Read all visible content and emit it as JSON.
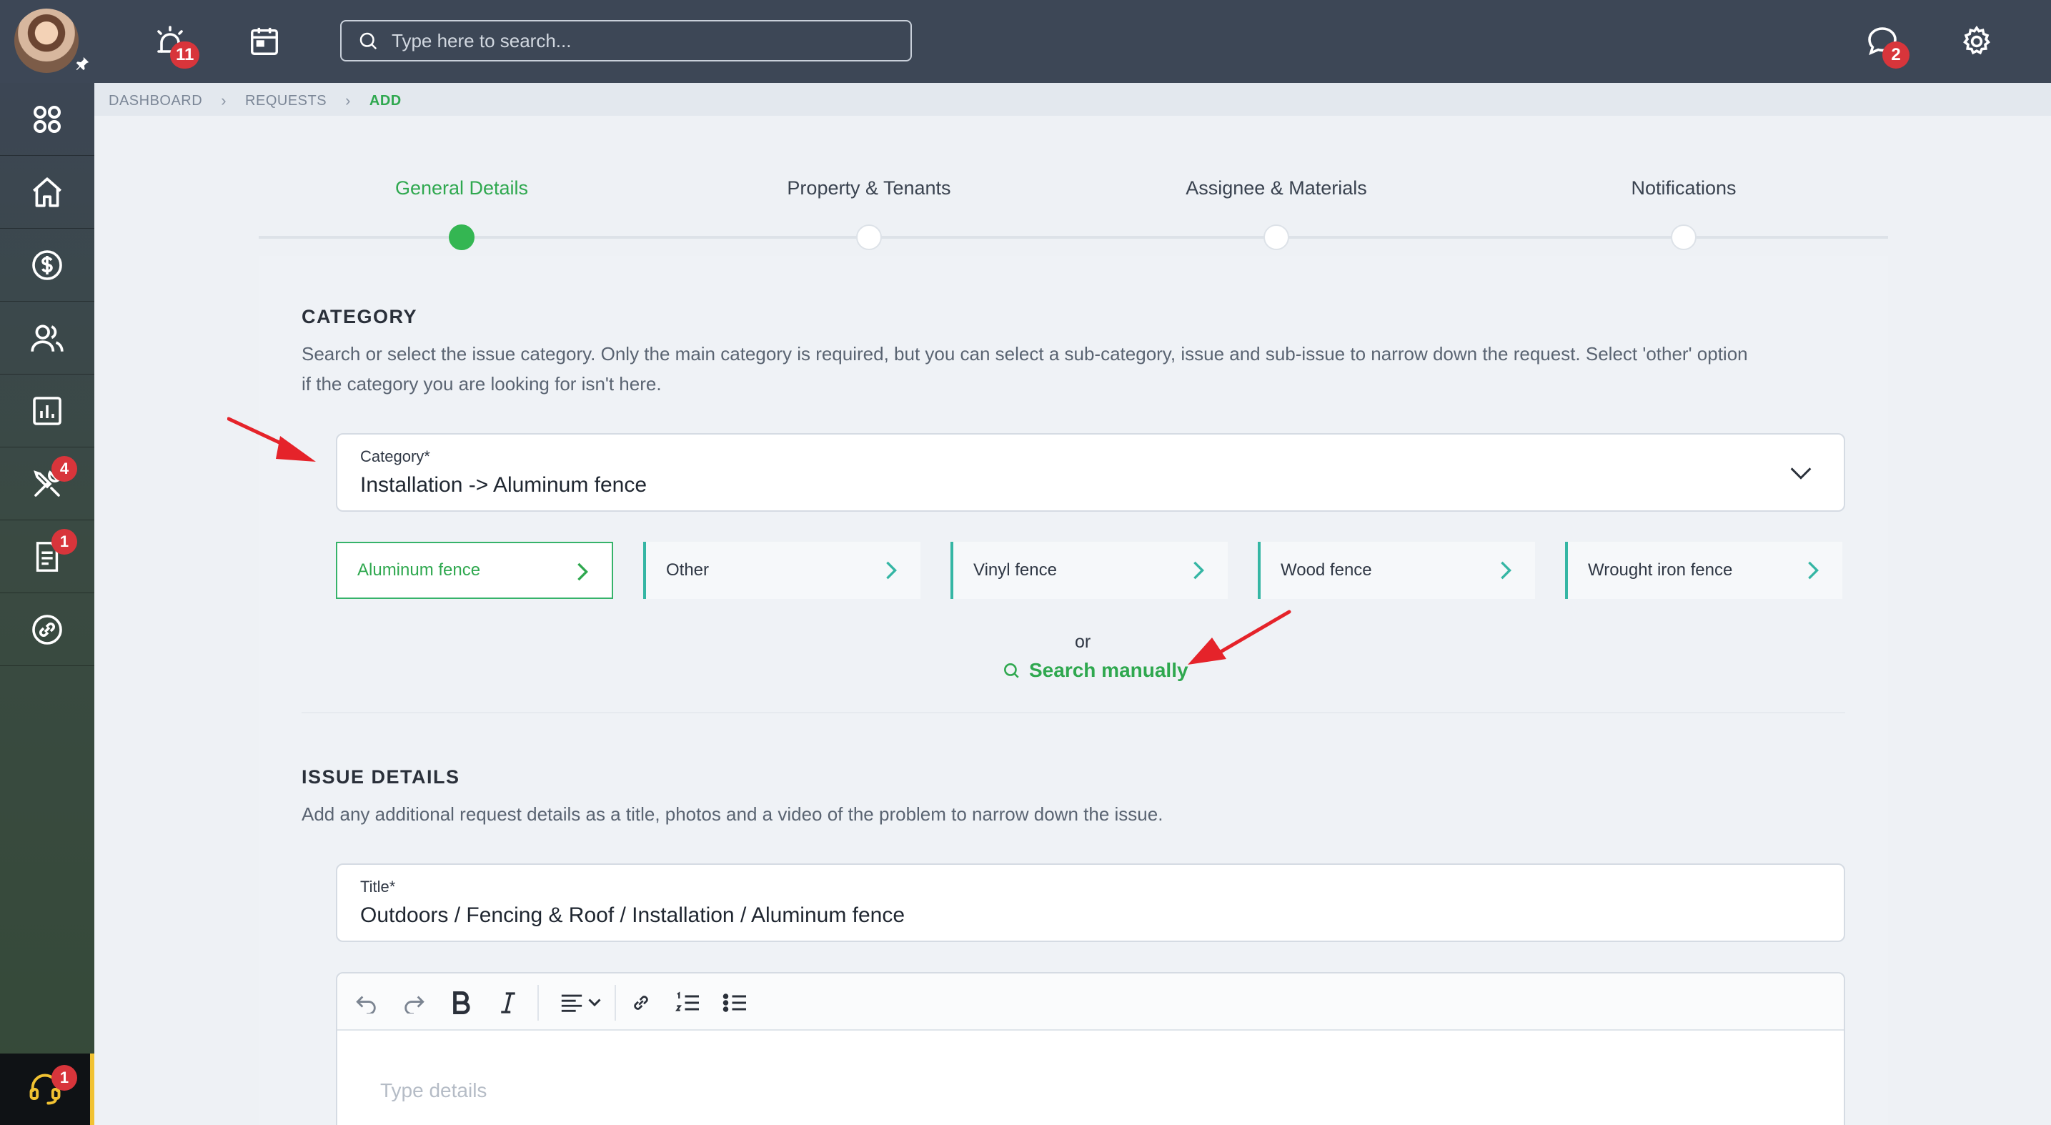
{
  "header": {
    "search_placeholder": "Type here to search...",
    "alarm_badge": "11",
    "chat_badge": "2"
  },
  "sidebar": {
    "items": [
      {
        "icon": "dashboard-icon",
        "badge": ""
      },
      {
        "icon": "home-icon",
        "badge": ""
      },
      {
        "icon": "dollar-icon",
        "badge": ""
      },
      {
        "icon": "people-icon",
        "badge": ""
      },
      {
        "icon": "reports-icon",
        "badge": ""
      },
      {
        "icon": "tools-icon",
        "badge": "4"
      },
      {
        "icon": "document-icon",
        "badge": "1"
      },
      {
        "icon": "link-icon",
        "badge": ""
      }
    ],
    "support_badge": "1"
  },
  "breadcrumb": {
    "items": [
      "DASHBOARD",
      "REQUESTS",
      "ADD"
    ]
  },
  "steps": [
    {
      "label": "General Details",
      "active": true
    },
    {
      "label": "Property & Tenants",
      "active": false
    },
    {
      "label": "Assignee & Materials",
      "active": false
    },
    {
      "label": "Notifications",
      "active": false
    }
  ],
  "category": {
    "title": "CATEGORY",
    "desc_line1": "Search or select the issue category. Only the main category is required, but you can select a sub-category, issue and sub-issue to narrow down the request. Select 'other' option",
    "desc_line2": "if the category you are looking for isn't here.",
    "field_label": "Category*",
    "field_value": "Installation -> Aluminum fence",
    "options": [
      "Aluminum fence",
      "Other",
      "Vinyl fence",
      "Wood fence",
      "Wrought iron fence"
    ],
    "selected_option": "Aluminum fence",
    "or_text": "or",
    "search_manually": "Search manually"
  },
  "issue_details": {
    "title": "ISSUE DETAILS",
    "desc": "Add any additional request details as a title, photos and a video of the problem to narrow down the issue.",
    "title_label": "Title*",
    "title_value": "Outdoors / Fencing & Roof / Installation / Aluminum fence",
    "details_placeholder": "Type details"
  },
  "colors": {
    "accent_green": "#2fa84f",
    "topbar": "#3d4756",
    "badge_red": "#d8353b",
    "chip_border": "#35b6a4",
    "annotation_arrow": "#e5232a"
  }
}
